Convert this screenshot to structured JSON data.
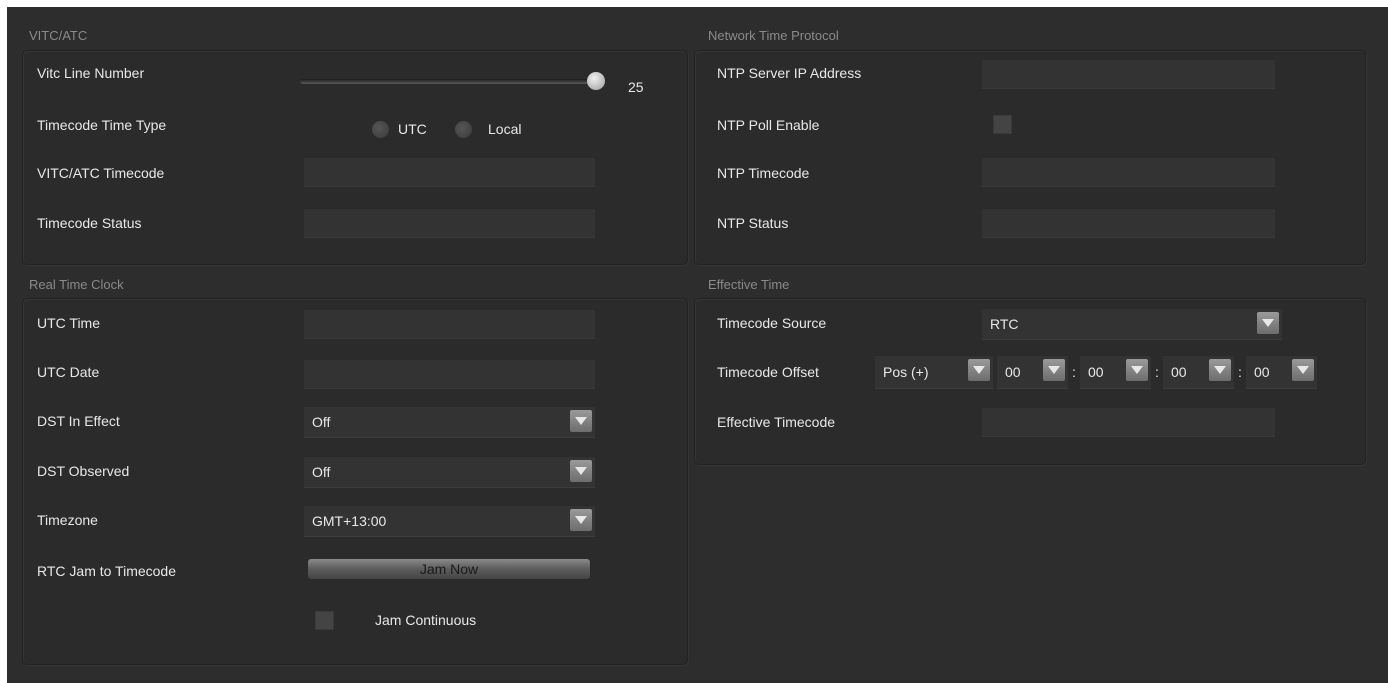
{
  "vitc": {
    "title": "VITC/ATC",
    "line_number_label": "Vitc Line Number",
    "line_number_value": "25",
    "line_number_level": 1.0,
    "time_type_label": "Timecode Time Type",
    "time_type_options": [
      "UTC",
      "Local"
    ],
    "timecode_label": "VITC/ATC Timecode",
    "timecode_value": "",
    "status_label": "Timecode Status",
    "status_value": ""
  },
  "ntp": {
    "title": "Network Time Protocol",
    "server_ip_label": "NTP Server IP Address",
    "server_ip_value": "",
    "poll_enable_label": "NTP Poll Enable",
    "timecode_label": "NTP Timecode",
    "timecode_value": "",
    "status_label": "NTP Status",
    "status_value": ""
  },
  "rtc": {
    "title": "Real Time Clock",
    "utc_time_label": "UTC Time",
    "utc_time_value": "",
    "utc_date_label": "UTC Date",
    "utc_date_value": "",
    "dst_in_effect_label": "DST In Effect",
    "dst_in_effect_value": "Off",
    "dst_observed_label": "DST Observed",
    "dst_observed_value": "Off",
    "timezone_label": "Timezone",
    "timezone_value": "GMT+13:00",
    "jam_label": "RTC Jam to Timecode",
    "jam_button": "Jam Now",
    "jam_continuous_label": "Jam Continuous"
  },
  "effective": {
    "title": "Effective Time",
    "source_label": "Timecode Source",
    "source_value": "RTC",
    "offset_label": "Timecode Offset",
    "offset_sign": "Pos (+)",
    "offset_hours": "00",
    "offset_minutes": "00",
    "offset_seconds": "00",
    "offset_frames": "00",
    "separator": ":",
    "effective_label": "Effective Timecode",
    "effective_value": ""
  }
}
